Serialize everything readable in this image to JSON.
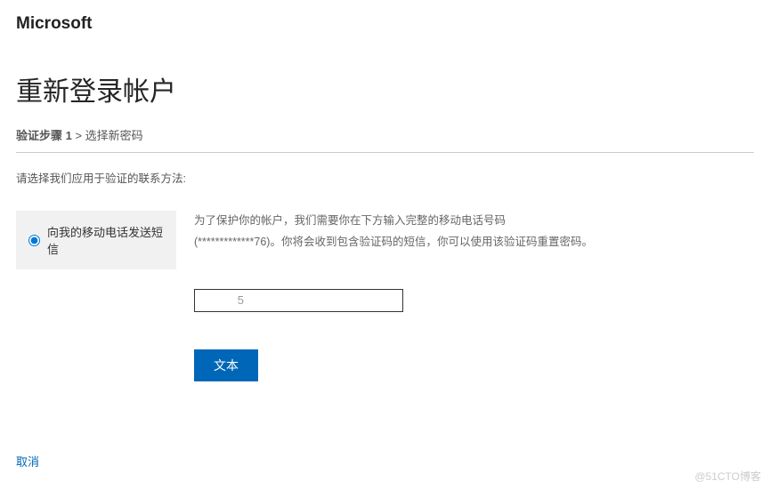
{
  "brand": "Microsoft",
  "title": "重新登录帐户",
  "breadcrumb": {
    "current": "验证步骤 1",
    "sep": " > ",
    "next": "选择新密码"
  },
  "instructions": "请选择我们应用于验证的联系方法:",
  "verification": {
    "option_label": "向我的移动电话发送短信",
    "description_line1": "为了保护你的帐户，我们需要你在下方输入完整的移动电话号码",
    "description_line2": "(*************76)。你将会收到包含验证码的短信，你可以使用该验证码重置密码。",
    "phone_value": "           5"
  },
  "primary_button": "文本",
  "cancel_link": "取消",
  "watermark": "@51CTO博客"
}
